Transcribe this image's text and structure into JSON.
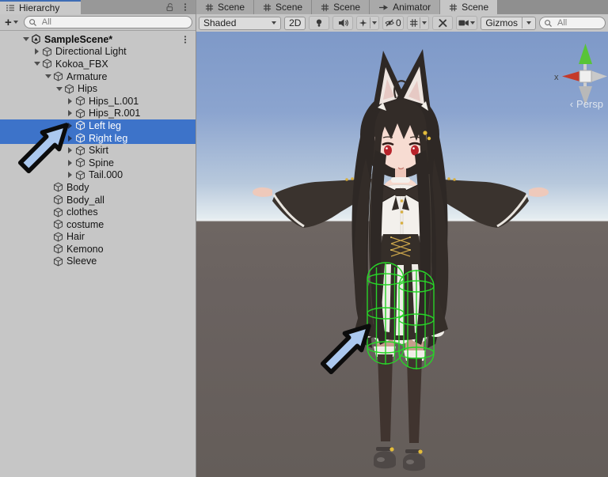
{
  "hierarchy": {
    "tab": "Hierarchy",
    "add_button": "+",
    "search": {
      "placeholder": "All"
    },
    "rows": [
      {
        "label": "SampleScene*",
        "selected": false
      },
      {
        "label": "Directional Light",
        "selected": false
      },
      {
        "label": "Kokoa_FBX",
        "selected": false
      },
      {
        "label": "Armature",
        "selected": false
      },
      {
        "label": "Hips",
        "selected": false
      },
      {
        "label": "Hips_L.001",
        "selected": false
      },
      {
        "label": "Hips_R.001",
        "selected": false
      },
      {
        "label": "Left leg",
        "selected": true
      },
      {
        "label": "Right leg",
        "selected": true
      },
      {
        "label": "Skirt",
        "selected": false
      },
      {
        "label": "Spine",
        "selected": false
      },
      {
        "label": "Tail.000",
        "selected": false
      },
      {
        "label": "Body",
        "selected": false
      },
      {
        "label": "Body_all",
        "selected": false
      },
      {
        "label": "clothes",
        "selected": false
      },
      {
        "label": "costume",
        "selected": false
      },
      {
        "label": "Hair",
        "selected": false
      },
      {
        "label": "Kemono",
        "selected": false
      },
      {
        "label": "Sleeve",
        "selected": false
      }
    ]
  },
  "scene": {
    "tabs": [
      {
        "label": "Scene"
      },
      {
        "label": "Scene"
      },
      {
        "label": "Scene"
      },
      {
        "label": "Animator"
      },
      {
        "label": "Scene"
      }
    ],
    "toolbar": {
      "shading_mode": "Shaded",
      "mode_2d": "2D",
      "hidden_objects_count": "0",
      "gizmos": "Gizmos",
      "search_placeholder": "All"
    },
    "viewport": {
      "axis_label_x": "x",
      "projection_label": "Persp",
      "projection_chevron": "‹"
    }
  },
  "colors": {
    "selection_blue": "#3d73c9",
    "annotation_arrow_fill": "#abc8ef",
    "annotation_arrow_outline": "#0c0c0c",
    "collider_wireframe_green": "#28d228",
    "sky_top": "#7e99c8",
    "sky_horizon": "#e8eef1",
    "ground": "#6a6260",
    "axis_y_green": "#58c438",
    "axis_x_red": "#c43a2b"
  }
}
